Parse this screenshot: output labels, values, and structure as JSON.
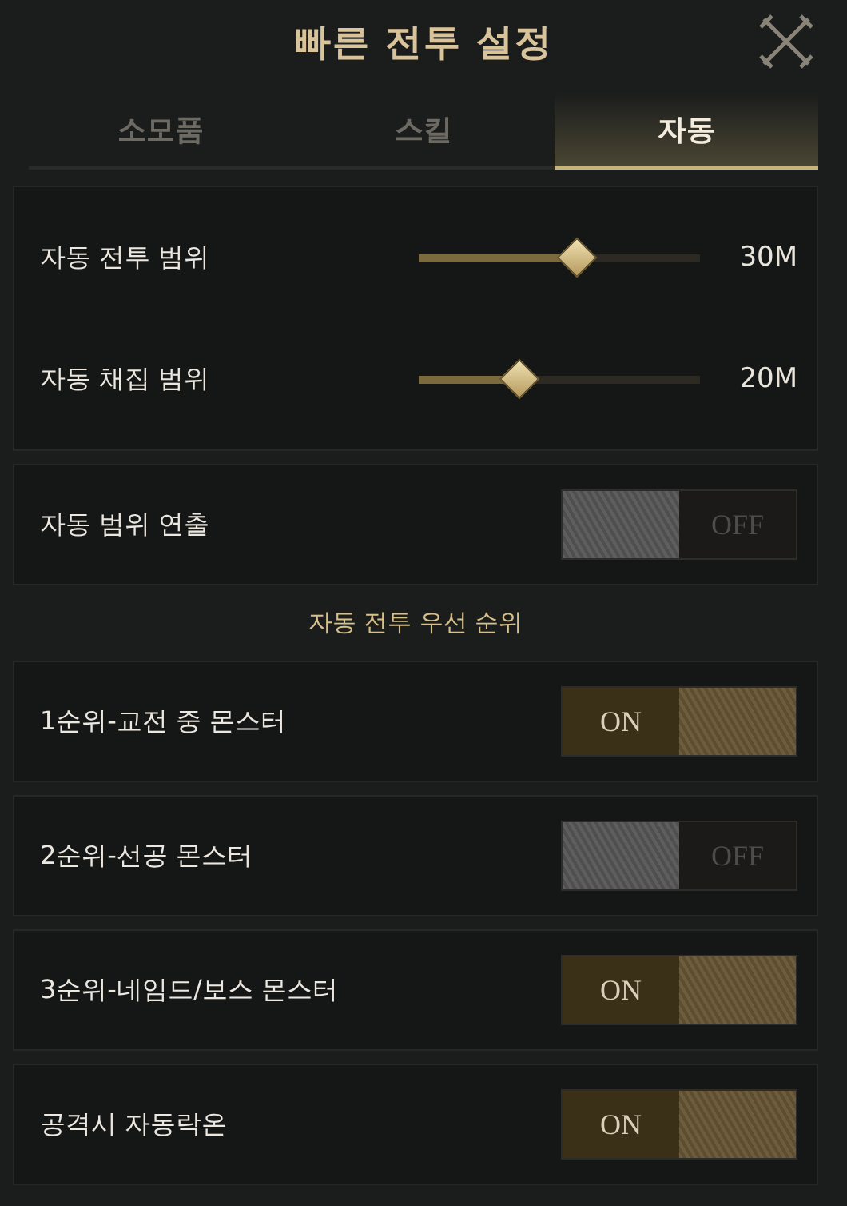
{
  "window": {
    "title": "빠른 전투 설정"
  },
  "tabs": [
    {
      "label": "소모품",
      "selected": false
    },
    {
      "label": "스킬",
      "selected": false
    },
    {
      "label": "자동",
      "selected": true
    }
  ],
  "sections": [
    {
      "kind": "sliders",
      "items": [
        {
          "label": "자동 전투 범위",
          "level": 0.56,
          "reading": "30M"
        },
        {
          "label": "자동 채집 범위",
          "level": 0.36,
          "reading": "20M"
        }
      ]
    },
    {
      "kind": "toggle",
      "label": "자동 범위 연출",
      "on": false,
      "state_label": "OFF"
    },
    {
      "kind": "heading",
      "text": "자동 전투 우선 순위"
    },
    {
      "kind": "toggle",
      "label": "1순위-교전 중 몬스터",
      "on": true,
      "state_label": "ON"
    },
    {
      "kind": "toggle",
      "label": "2순위-선공 몬스터",
      "on": false,
      "state_label": "OFF"
    },
    {
      "kind": "toggle",
      "label": "3순위-네임드/보스 몬스터",
      "on": true,
      "state_label": "ON"
    },
    {
      "kind": "toggle",
      "label": "공격시 자동락온",
      "on": true,
      "state_label": "ON"
    }
  ]
}
